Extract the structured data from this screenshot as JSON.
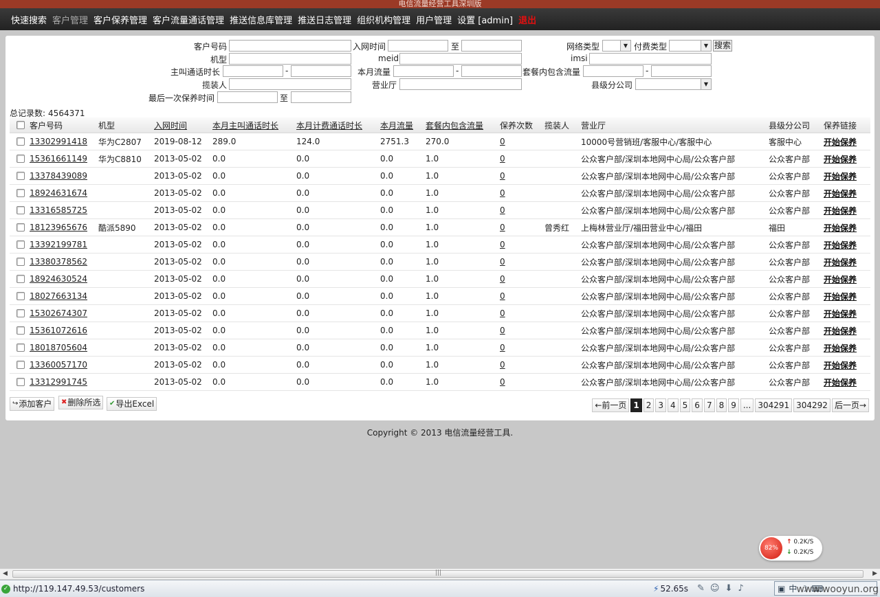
{
  "window": {
    "title": "电信流量经营工具深圳版"
  },
  "nav": {
    "items": [
      {
        "label": "快速搜索"
      },
      {
        "label": "客户管理",
        "active": true
      },
      {
        "label": "客户保养管理"
      },
      {
        "label": "客户流量通话管理"
      },
      {
        "label": "推送信息库管理"
      },
      {
        "label": "推送日志管理"
      },
      {
        "label": "组织机构管理"
      },
      {
        "label": "用户管理"
      },
      {
        "label": "设置 [admin]"
      }
    ],
    "logout": "退出"
  },
  "search": {
    "customer_no_label": "客户号码",
    "join_time_label": "入网时间",
    "to_label": "至",
    "network_type_label": "网络类型",
    "pay_type_label": "付费类型",
    "search_button": "搜索",
    "model_label": "机型",
    "meid_label": "meid",
    "imsi_label": "imsi",
    "call_duration_label": "主叫通话时长",
    "month_flow_label": "本月流量",
    "package_flow_label": "套餐内包含流量",
    "dash": "-",
    "installer_label": "揽装人",
    "hall_label": "营业厅",
    "county_branch_label": "县级分公司",
    "last_maintain_label": "最后一次保养时间"
  },
  "total": {
    "label": "总记录数:",
    "value": "4564371"
  },
  "table": {
    "headers": {
      "customer_no": "客户号码",
      "model": "机型",
      "join_time": "入网时间",
      "call_duration": "本月主叫通话时长",
      "billing_duration": "本月计费通话时长",
      "month_flow": "本月流量",
      "package_flow": "套餐内包含流量",
      "maintain_count": "保养次数",
      "installer": "揽装人",
      "hall": "营业厅",
      "county_branch": "县级分公司",
      "maintain_link": "保养链接"
    },
    "rows": [
      {
        "no": "13302991418",
        "model": "华为C2807",
        "join": "2019-08-12",
        "call": "289.0",
        "bill": "124.0",
        "flow": "2751.3",
        "pkg": "270.0",
        "count": "0",
        "installer": "",
        "hall": "10000号营销班/客服中心/客服中心",
        "county": "客服中心",
        "link": "开始保养"
      },
      {
        "no": "15361661149",
        "model": "华为C8810",
        "join": "2013-05-02",
        "call": "0.0",
        "bill": "0.0",
        "flow": "0.0",
        "pkg": "1.0",
        "count": "0",
        "installer": "",
        "hall": "公众客户部/深圳本地网中心局/公众客户部",
        "county": "公众客户部",
        "link": "开始保养"
      },
      {
        "no": "13378439089",
        "model": "",
        "join": "2013-05-02",
        "call": "0.0",
        "bill": "0.0",
        "flow": "0.0",
        "pkg": "1.0",
        "count": "0",
        "installer": "",
        "hall": "公众客户部/深圳本地网中心局/公众客户部",
        "county": "公众客户部",
        "link": "开始保养"
      },
      {
        "no": "18924631674",
        "model": "",
        "join": "2013-05-02",
        "call": "0.0",
        "bill": "0.0",
        "flow": "0.0",
        "pkg": "1.0",
        "count": "0",
        "installer": "",
        "hall": "公众客户部/深圳本地网中心局/公众客户部",
        "county": "公众客户部",
        "link": "开始保养"
      },
      {
        "no": "13316585725",
        "model": "",
        "join": "2013-05-02",
        "call": "0.0",
        "bill": "0.0",
        "flow": "0.0",
        "pkg": "1.0",
        "count": "0",
        "installer": "",
        "hall": "公众客户部/深圳本地网中心局/公众客户部",
        "county": "公众客户部",
        "link": "开始保养"
      },
      {
        "no": "18123965676",
        "model": "酷派5890",
        "join": "2013-05-02",
        "call": "0.0",
        "bill": "0.0",
        "flow": "0.0",
        "pkg": "1.0",
        "count": "0",
        "installer": "曾秀红",
        "hall": "上梅林营业厅/福田营业中心/福田",
        "county": "福田",
        "link": "开始保养"
      },
      {
        "no": "13392199781",
        "model": "",
        "join": "2013-05-02",
        "call": "0.0",
        "bill": "0.0",
        "flow": "0.0",
        "pkg": "1.0",
        "count": "0",
        "installer": "",
        "hall": "公众客户部/深圳本地网中心局/公众客户部",
        "county": "公众客户部",
        "link": "开始保养"
      },
      {
        "no": "13380378562",
        "model": "",
        "join": "2013-05-02",
        "call": "0.0",
        "bill": "0.0",
        "flow": "0.0",
        "pkg": "1.0",
        "count": "0",
        "installer": "",
        "hall": "公众客户部/深圳本地网中心局/公众客户部",
        "county": "公众客户部",
        "link": "开始保养"
      },
      {
        "no": "18924630524",
        "model": "",
        "join": "2013-05-02",
        "call": "0.0",
        "bill": "0.0",
        "flow": "0.0",
        "pkg": "1.0",
        "count": "0",
        "installer": "",
        "hall": "公众客户部/深圳本地网中心局/公众客户部",
        "county": "公众客户部",
        "link": "开始保养"
      },
      {
        "no": "18027663134",
        "model": "",
        "join": "2013-05-02",
        "call": "0.0",
        "bill": "0.0",
        "flow": "0.0",
        "pkg": "1.0",
        "count": "0",
        "installer": "",
        "hall": "公众客户部/深圳本地网中心局/公众客户部",
        "county": "公众客户部",
        "link": "开始保养"
      },
      {
        "no": "15302674307",
        "model": "",
        "join": "2013-05-02",
        "call": "0.0",
        "bill": "0.0",
        "flow": "0.0",
        "pkg": "1.0",
        "count": "0",
        "installer": "",
        "hall": "公众客户部/深圳本地网中心局/公众客户部",
        "county": "公众客户部",
        "link": "开始保养"
      },
      {
        "no": "15361072616",
        "model": "",
        "join": "2013-05-02",
        "call": "0.0",
        "bill": "0.0",
        "flow": "0.0",
        "pkg": "1.0",
        "count": "0",
        "installer": "",
        "hall": "公众客户部/深圳本地网中心局/公众客户部",
        "county": "公众客户部",
        "link": "开始保养"
      },
      {
        "no": "18018705604",
        "model": "",
        "join": "2013-05-02",
        "call": "0.0",
        "bill": "0.0",
        "flow": "0.0",
        "pkg": "1.0",
        "count": "0",
        "installer": "",
        "hall": "公众客户部/深圳本地网中心局/公众客户部",
        "county": "公众客户部",
        "link": "开始保养"
      },
      {
        "no": "13360057170",
        "model": "",
        "join": "2013-05-02",
        "call": "0.0",
        "bill": "0.0",
        "flow": "0.0",
        "pkg": "1.0",
        "count": "0",
        "installer": "",
        "hall": "公众客户部/深圳本地网中心局/公众客户部",
        "county": "公众客户部",
        "link": "开始保养"
      },
      {
        "no": "13312991745",
        "model": "",
        "join": "2013-05-02",
        "call": "0.0",
        "bill": "0.0",
        "flow": "0.0",
        "pkg": "1.0",
        "count": "0",
        "installer": "",
        "hall": "公众客户部/深圳本地网中心局/公众客户部",
        "county": "公众客户部",
        "link": "开始保养"
      }
    ]
  },
  "toolbar": {
    "add": "添加客户",
    "delete": "删除所选",
    "export": "导出Excel"
  },
  "pager": {
    "prev": "←前一页",
    "pages": [
      "1",
      "2",
      "3",
      "4",
      "5",
      "6",
      "7",
      "8",
      "9",
      "...",
      "304291",
      "304292"
    ],
    "current": "1",
    "next": "后一页→"
  },
  "footer": {
    "copyright": "Copyright © 2013 电信流量经营工具."
  },
  "net_monitor": {
    "percent": "82%",
    "up": "0.2K/S",
    "down": "0.2K/S"
  },
  "statusbar": {
    "url": "http://119.147.49.53/customers",
    "speed": "52.65s",
    "tray_label": "中",
    "watermark": "www.wooyun.org"
  }
}
